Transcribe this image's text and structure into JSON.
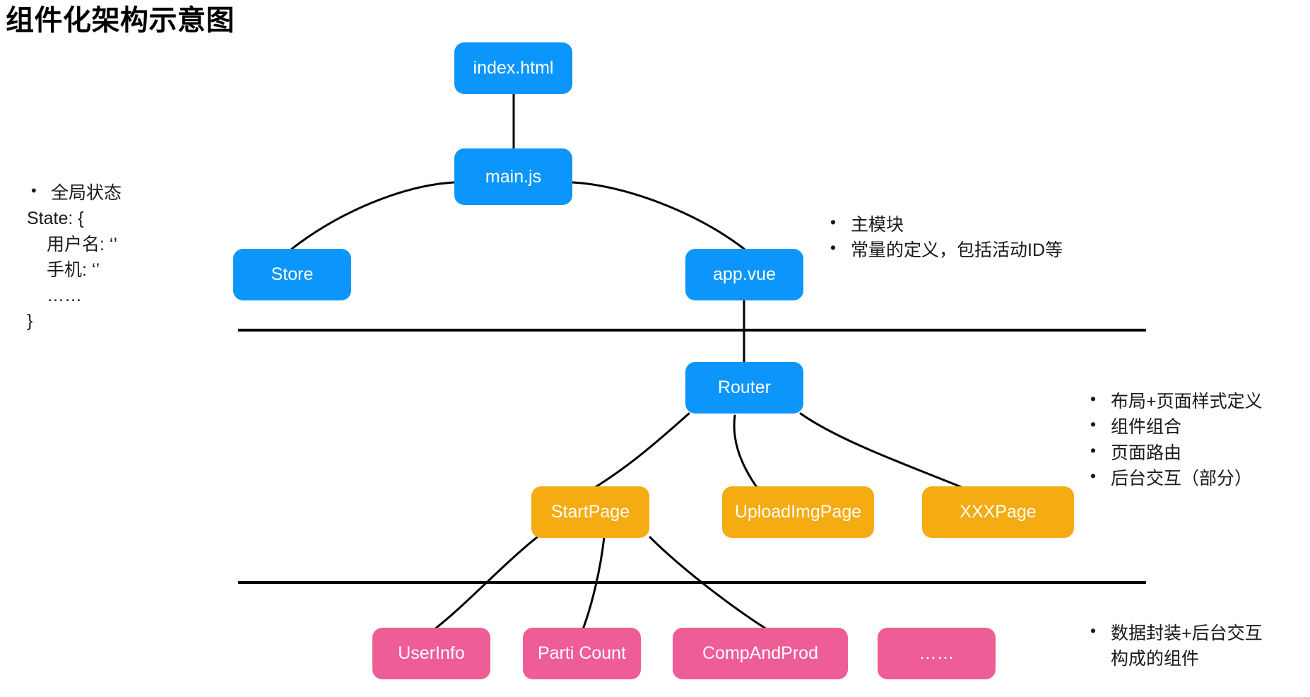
{
  "title": "组件化架构示意图",
  "colors": {
    "blue": "#0c96fb",
    "orange": "#f5ab12",
    "pink": "#ee5d96",
    "line": "#000000",
    "background": "#ffffff"
  },
  "nodes": {
    "index_html": "index.html",
    "main_js": "main.js",
    "store": "Store",
    "app_vue": "app.vue",
    "router": "Router",
    "start_page": "StartPage",
    "upload_img_page": "UploadImgPage",
    "xxx_page": "XXXPage",
    "user_info": "UserInfo",
    "parti_count": "Parti Count",
    "comp_and_prod": "CompAndProd",
    "more_components": "……"
  },
  "state_note": {
    "bullet": "全局状态",
    "line_open": "State: {",
    "line_username": "用户名: ‘’",
    "line_phone": "手机: ‘’",
    "line_ellipsis": "……",
    "line_close": "}"
  },
  "app_note": {
    "items": [
      "主模块",
      "常量的定义，包括活动ID等"
    ]
  },
  "router_note": {
    "items": [
      "布局+页面样式定义",
      "组件组合",
      "页面路由",
      "后台交互（部分）"
    ]
  },
  "component_note": {
    "items": [
      {
        "line1": "数据封装+后台交互",
        "line2": "构成的组件"
      }
    ]
  }
}
